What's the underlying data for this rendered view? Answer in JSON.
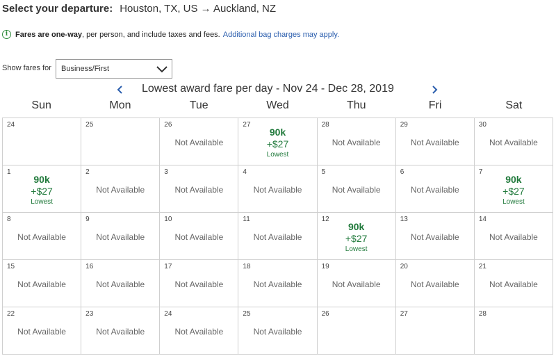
{
  "header": {
    "label": "Select your departure:",
    "route": "Houston, TX, US → Auckland, NZ"
  },
  "info": {
    "icon": "info-circle-icon",
    "bold_text": "Fares are one-way",
    "text": ", per person, and include taxes and fees.",
    "link_text": "Additional bag charges may apply."
  },
  "filter": {
    "label": "Show fares for",
    "selected": "Business/First"
  },
  "calendar": {
    "title": "Lowest award fare per day - Nov 24 - Dec 28, 2019",
    "days_of_week": [
      "Sun",
      "Mon",
      "Tue",
      "Wed",
      "Thu",
      "Fri",
      "Sat"
    ],
    "not_available_label": "Not Available",
    "fare_color": "#217a3c",
    "cells": [
      {
        "day": "24",
        "status": "none"
      },
      {
        "day": "25",
        "status": "none"
      },
      {
        "day": "26",
        "status": "na"
      },
      {
        "day": "27",
        "status": "fare",
        "miles": "90k",
        "tax": "+$27",
        "note": "Lowest"
      },
      {
        "day": "28",
        "status": "na"
      },
      {
        "day": "29",
        "status": "na"
      },
      {
        "day": "30",
        "status": "na"
      },
      {
        "day": "1",
        "status": "fare",
        "miles": "90k",
        "tax": "+$27",
        "note": "Lowest"
      },
      {
        "day": "2",
        "status": "na"
      },
      {
        "day": "3",
        "status": "na"
      },
      {
        "day": "4",
        "status": "na"
      },
      {
        "day": "5",
        "status": "na"
      },
      {
        "day": "6",
        "status": "na"
      },
      {
        "day": "7",
        "status": "fare",
        "miles": "90k",
        "tax": "+$27",
        "note": "Lowest"
      },
      {
        "day": "8",
        "status": "na"
      },
      {
        "day": "9",
        "status": "na"
      },
      {
        "day": "10",
        "status": "na"
      },
      {
        "day": "11",
        "status": "na"
      },
      {
        "day": "12",
        "status": "fare",
        "miles": "90k",
        "tax": "+$27",
        "note": "Lowest"
      },
      {
        "day": "13",
        "status": "na"
      },
      {
        "day": "14",
        "status": "na"
      },
      {
        "day": "15",
        "status": "na"
      },
      {
        "day": "16",
        "status": "na"
      },
      {
        "day": "17",
        "status": "na"
      },
      {
        "day": "18",
        "status": "na"
      },
      {
        "day": "19",
        "status": "na"
      },
      {
        "day": "20",
        "status": "na"
      },
      {
        "day": "21",
        "status": "na"
      },
      {
        "day": "22",
        "status": "na"
      },
      {
        "day": "23",
        "status": "na"
      },
      {
        "day": "24",
        "status": "na"
      },
      {
        "day": "25",
        "status": "na"
      },
      {
        "day": "26",
        "status": "none"
      },
      {
        "day": "27",
        "status": "none"
      },
      {
        "day": "28",
        "status": "none"
      }
    ]
  }
}
